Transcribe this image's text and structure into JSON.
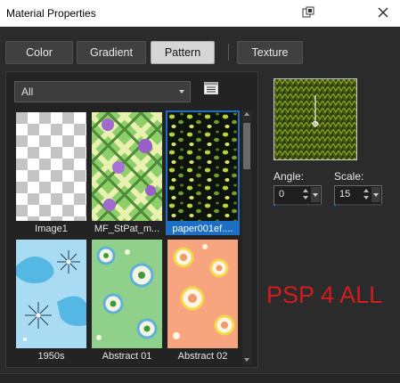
{
  "window": {
    "title": "Material Properties",
    "icons": {
      "pin": "pin-window-icon",
      "close": "close-icon"
    }
  },
  "tabs": [
    {
      "label": "Color",
      "active": false
    },
    {
      "label": "Gradient",
      "active": false
    },
    {
      "label": "Pattern",
      "active": true
    },
    {
      "label": "Texture",
      "active": false
    }
  ],
  "filter": {
    "selected": "All",
    "icon": "list-view-icon"
  },
  "patterns": [
    {
      "name": "Image1",
      "selected": false
    },
    {
      "name": "MF_StPat_m...",
      "selected": false
    },
    {
      "name": "paper001ef....",
      "selected": true
    },
    {
      "name": "1950s",
      "selected": false
    },
    {
      "name": "Abstract 01",
      "selected": false
    },
    {
      "name": "Abstract 02",
      "selected": false
    }
  ],
  "angle": {
    "label": "Angle:",
    "value": "0"
  },
  "scale": {
    "label": "Scale:",
    "value": "15",
    "level_fraction": 0.03
  },
  "watermark": "PSP 4 ALL",
  "colors": {
    "accent": "#1c6fc4",
    "background": "#2b2b2b",
    "watermark": "#d11d1d"
  }
}
